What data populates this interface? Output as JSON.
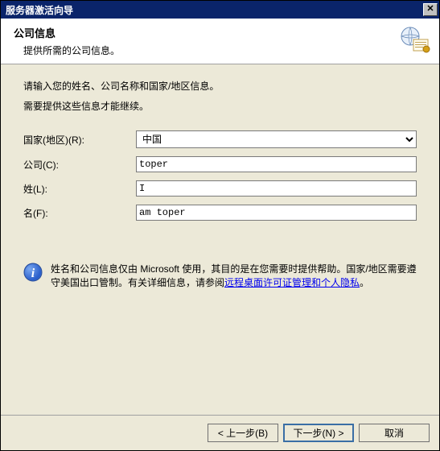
{
  "window": {
    "title": "服务器激活向导"
  },
  "header": {
    "title": "公司信息",
    "subtitle": "提供所需的公司信息。"
  },
  "content": {
    "instruction1": "请输入您的姓名、公司名称和国家/地区信息。",
    "instruction2": "需要提供这些信息才能继续。"
  },
  "form": {
    "country": {
      "label": "国家(地区)(R):",
      "value": "中国"
    },
    "company": {
      "label": "公司(C):",
      "value": "toper"
    },
    "lastname": {
      "label": "姓(L):",
      "value": "I"
    },
    "firstname": {
      "label": "名(F):",
      "value": "am toper"
    }
  },
  "info": {
    "text_before": "姓名和公司信息仅由 Microsoft 使用，其目的是在您需要时提供帮助。国家/地区需要遵守美国出口管制。有关详细信息，请参阅",
    "link": "远程桌面许可证管理和个人隐私",
    "text_after": "。"
  },
  "footer": {
    "back": "< 上一步(B)",
    "next": "下一步(N) >",
    "cancel": "取消"
  }
}
